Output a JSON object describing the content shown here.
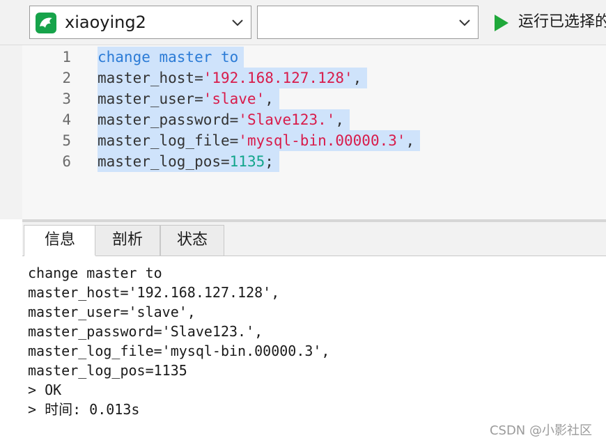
{
  "toolbar": {
    "connection": {
      "label": "xiaoying2",
      "icon": "dolphin-icon"
    },
    "database": {
      "label": ""
    },
    "run": {
      "label": "运行已选择的",
      "icon": "play-icon"
    }
  },
  "editor": {
    "lines": [
      {
        "n": "1",
        "parts": [
          {
            "t": "change master to",
            "c": "kw"
          }
        ]
      },
      {
        "n": "2",
        "parts": [
          {
            "t": "master_host=",
            "c": ""
          },
          {
            "t": "'192.168.127.128'",
            "c": "str"
          },
          {
            "t": ",",
            "c": ""
          }
        ]
      },
      {
        "n": "3",
        "parts": [
          {
            "t": "master_user=",
            "c": ""
          },
          {
            "t": "'slave'",
            "c": "str"
          },
          {
            "t": ",",
            "c": ""
          }
        ]
      },
      {
        "n": "4",
        "parts": [
          {
            "t": "master_password=",
            "c": ""
          },
          {
            "t": "'Slave123.'",
            "c": "str"
          },
          {
            "t": ",",
            "c": ""
          }
        ]
      },
      {
        "n": "5",
        "parts": [
          {
            "t": "master_log_file=",
            "c": ""
          },
          {
            "t": "'mysql-bin.00000.3'",
            "c": "str"
          },
          {
            "t": ",",
            "c": ""
          }
        ]
      },
      {
        "n": "6",
        "parts": [
          {
            "t": "master_log_pos=",
            "c": ""
          },
          {
            "t": "1135",
            "c": "num"
          },
          {
            "t": ";",
            "c": ""
          }
        ]
      }
    ]
  },
  "tabs": [
    "信息",
    "剖析",
    "状态"
  ],
  "output": {
    "lines": [
      "change master to",
      "master_host='192.168.127.128',",
      "master_user='slave',",
      "master_password='Slave123.',",
      "master_log_file='mysql-bin.00000.3',",
      "master_log_pos=1135",
      "> OK",
      "> 时间: 0.013s"
    ]
  },
  "watermark": "CSDN @小影社区",
  "colors": {
    "keyword": "#2b7bd6",
    "string": "#d81b4a",
    "number": "#12a58b",
    "selection": "#cfe3fb",
    "run_green": "#1fa83a"
  }
}
